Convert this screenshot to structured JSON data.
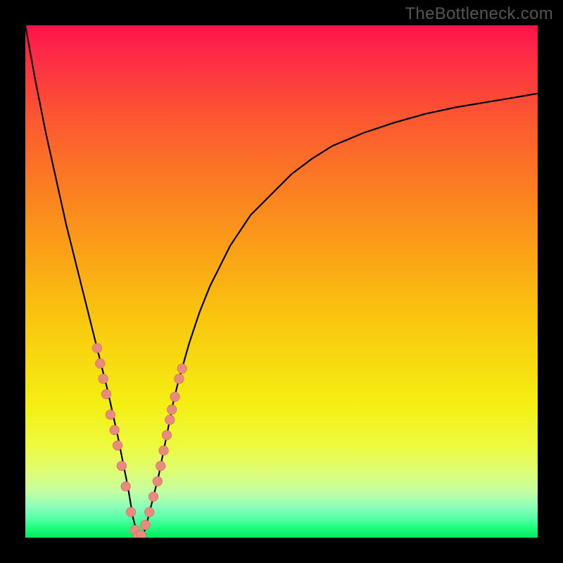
{
  "watermark": "TheBottleneck.com",
  "gradient_css": "linear-gradient(to bottom, #fd1147 0%, #fd2449 4%, #fc5731 18%, #fb8a1d 36%, #fac30e 56%, #f4ef12 74%, #edfa3f 82%, #dffd73 87%, #c3ffa1 91%, #8cffba 94%, #4fffa2 96.5%, #1fff7f 98%, #05e85d 100%)",
  "colors": {
    "curve": "#000000",
    "dot_fill": "#e98a7e",
    "dot_stroke": "#d06a60"
  },
  "chart_data": {
    "type": "line",
    "title": "",
    "xlabel": "",
    "ylabel": "",
    "xlim": [
      0,
      100
    ],
    "ylim": [
      0,
      100
    ],
    "series": [
      {
        "name": "bottleneck-curve",
        "x": [
          0,
          2,
          4,
          6,
          8,
          10,
          12,
          14,
          16,
          18,
          19,
          20,
          20.5,
          21,
          21.5,
          22,
          22.5,
          23,
          23.5,
          24,
          25,
          26,
          27,
          28,
          29,
          30,
          32,
          34,
          36,
          38,
          40,
          44,
          48,
          52,
          56,
          60,
          66,
          72,
          78,
          84,
          90,
          96,
          100
        ],
        "y": [
          100,
          89,
          79,
          70,
          61,
          53,
          45,
          37,
          29,
          20,
          15,
          10,
          7,
          4,
          2,
          0.6,
          0.2,
          0.6,
          2,
          4,
          8,
          12,
          17,
          22,
          27,
          31,
          38,
          44,
          49,
          53,
          57,
          63,
          67,
          71,
          74,
          76.5,
          79,
          81,
          82.7,
          84,
          85,
          86,
          86.7
        ]
      }
    ],
    "dots": {
      "name": "sample-points",
      "x": [
        14.0,
        14.6,
        15.2,
        15.8,
        16.6,
        17.4,
        18.0,
        18.8,
        19.6,
        20.6,
        21.4,
        22.0,
        22.6,
        23.4,
        24.2,
        25.0,
        25.8,
        26.4,
        27.0,
        27.6,
        28.2,
        28.6,
        29.2,
        30.0,
        30.6
      ],
      "y": [
        37.0,
        34.0,
        31.0,
        28.0,
        24.0,
        21.0,
        18.0,
        14.0,
        10.0,
        5.0,
        1.5,
        0.3,
        0.5,
        2.5,
        5.0,
        8.0,
        11.0,
        14.0,
        17.0,
        20.0,
        23.0,
        25.0,
        27.5,
        31.0,
        33.0
      ]
    }
  }
}
